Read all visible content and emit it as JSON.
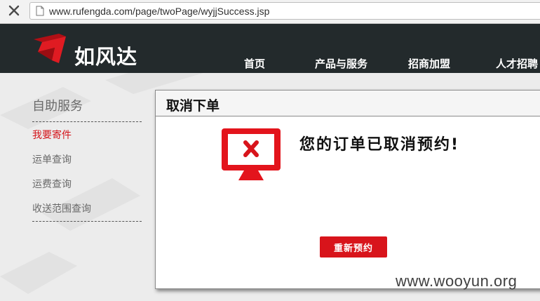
{
  "browser": {
    "url": "www.rufengda.com/page/twoPage/wyjjSuccess.jsp"
  },
  "header": {
    "logo_text": "如风达",
    "nav": [
      "首页",
      "产品与服务",
      "招商加盟",
      "人才招聘"
    ]
  },
  "sidebar": {
    "title": "自助服务",
    "items": [
      {
        "label": "我要寄件",
        "active": true
      },
      {
        "label": "运单查询",
        "active": false
      },
      {
        "label": "运费查询",
        "active": false
      },
      {
        "label": "收送范围查询",
        "active": false
      }
    ]
  },
  "dialog": {
    "title": "取消下单",
    "message": "您的订单已取消预约!",
    "button_label": "重新预约",
    "icon": "monitor-error-icon"
  },
  "watermark": "www.wooyun.org",
  "colors": {
    "accent": "#d8141b",
    "header_bg": "#232a2c"
  }
}
